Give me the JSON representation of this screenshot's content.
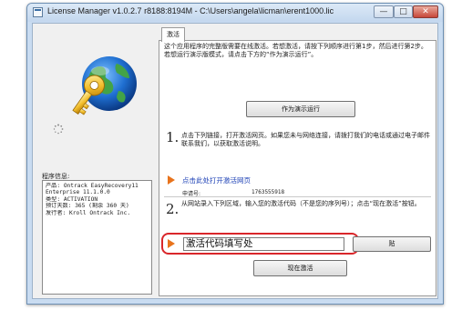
{
  "window": {
    "title": "License Manager v1.0.2.7 r8188:8194M - C:\\Users\\angela\\licman\\erent1000.lic",
    "controls": {
      "minimize": "—",
      "maximize": "□",
      "close": "✕"
    }
  },
  "sidebar": {
    "program_info_label": "程序信息:",
    "info_lines": [
      "产品: Ontrack EasyRecovery11",
      "Enterprise 11.1.0.0",
      "类型: ACTIVATION",
      "预订天数: 365 (剩余 360 天)",
      "发行者: Kroll Ontrack Inc."
    ]
  },
  "tab": {
    "label": "激活"
  },
  "intro_text": "这个应用程序的完整版需要在线激活。若想激活，请按下列顺序进行第1步，然后进行第2步。若想运行演示版模式，请点击下方的“作为演示运行”。",
  "demo_button_label": "作为演示运行",
  "step1": {
    "number": "1.",
    "text": "点击下列链接，打开激活网页。如果您未与网络连接，请拨打我们的电话或通过电子邮件联系我们，以获取激活说明。"
  },
  "activation_link": "点击此处打开激活网页",
  "serial": {
    "label": "申请号:",
    "value": "1763555918"
  },
  "step2": {
    "number": "2.",
    "text": "从网站录入下列区域，输入您的激活代码（不是您的序列号）；点击“现在激活”按钮。"
  },
  "activation_code_input": {
    "value": "激活代码填写处"
  },
  "paste_button_label": "贴",
  "activate_button_label": "现在激活",
  "colors": {
    "arrow": "#e8731c",
    "link": "#1b3fb5",
    "highlight": "#d9262a"
  }
}
